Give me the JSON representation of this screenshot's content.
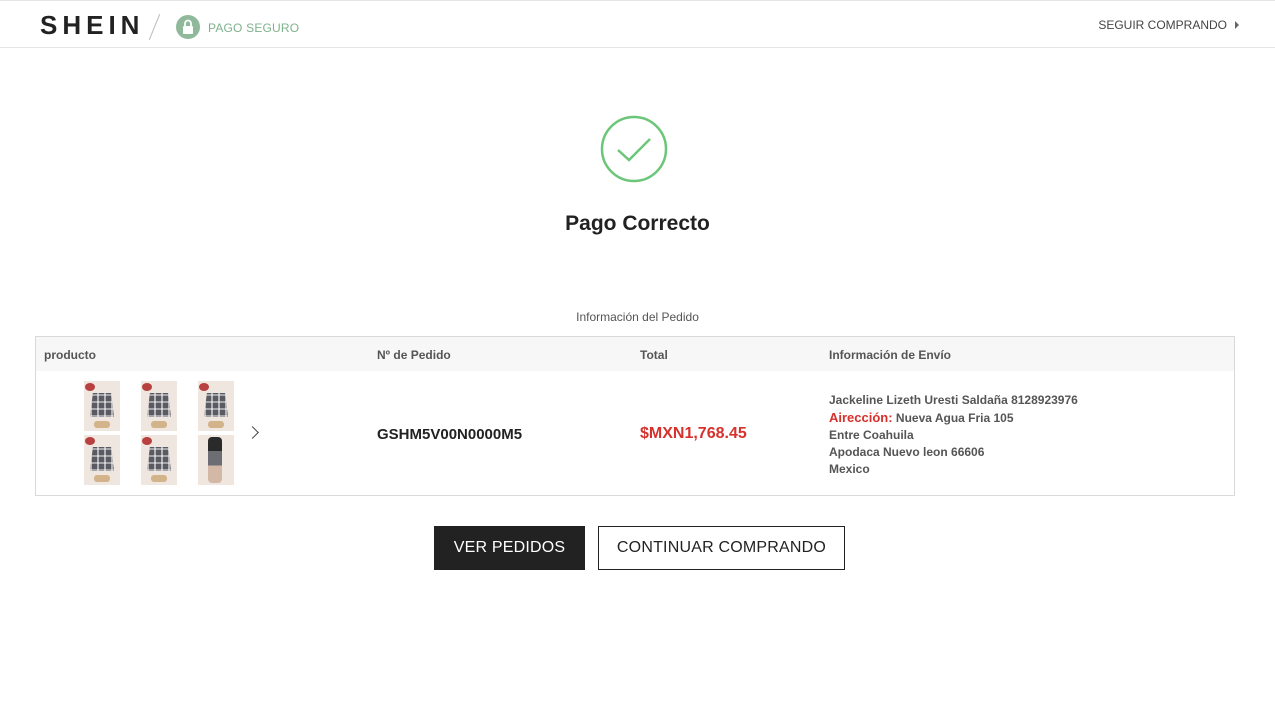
{
  "header": {
    "logo": "SHEIN",
    "secure_label": "PAGO SEGURO",
    "continue_link": "SEGUIR COMPRANDO",
    "colors": {
      "secure": "#7fb28b",
      "lock_bg": "#8fb99a"
    }
  },
  "status": {
    "title": "Pago Correcto",
    "icon": "check-circle-icon",
    "color": "#6cc67a"
  },
  "order_info": {
    "title": "Información del Pedido",
    "headers": {
      "product": "producto",
      "order_no": "Nº de Pedido",
      "total": "Total",
      "shipping": "Información de Envío"
    },
    "product_thumbnails": [
      "plaid-skirt-image",
      "plaid-skirt-image",
      "plaid-skirt-image",
      "plaid-skirt-image",
      "plaid-skirt-image",
      "model-wearing-skirt-image"
    ],
    "order_number": "GSHM5V00N0000M5",
    "total": "$MXN1,768.45",
    "shipping": {
      "name_phone": "Jackeline Lizeth Uresti Saldaña 8128923976",
      "address_label": "Airección:",
      "address_line1": "Nueva Agua Fria 105",
      "address_line2": "Entre Coahuila",
      "address_line3": "Apodaca Nuevo leon 66606",
      "country": "Mexico"
    },
    "colors": {
      "price": "#d6312c"
    }
  },
  "actions": {
    "view_orders": "VER PEDIDOS",
    "continue_shopping": "CONTINUAR COMPRANDO"
  }
}
